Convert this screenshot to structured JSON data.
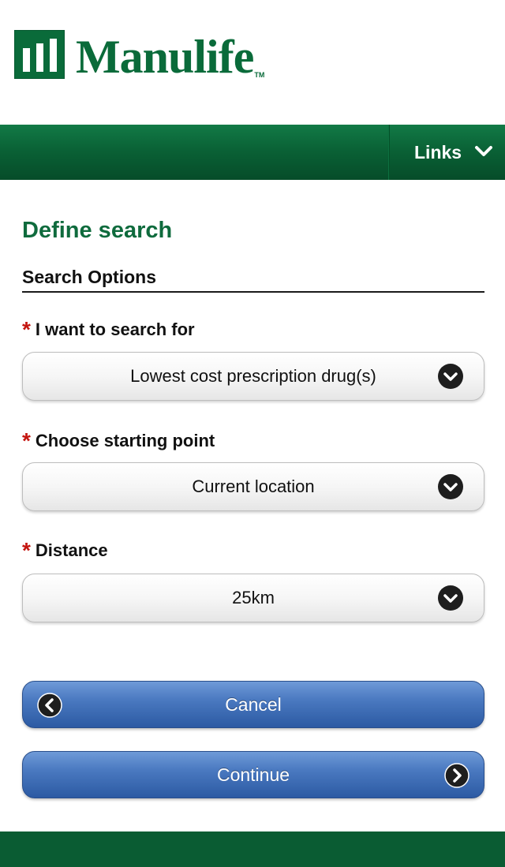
{
  "brand": {
    "name": "Manulife",
    "trademark": "TM",
    "color": "#0a6b3a"
  },
  "navbar": {
    "links_label": "Links",
    "links_icon": "chevron-down-icon"
  },
  "page": {
    "title": "Define search",
    "section_title": "Search Options"
  },
  "fields": [
    {
      "label": "I want to search for",
      "required_mark": "*",
      "value": "Lowest cost prescription drug(s)"
    },
    {
      "label": "Choose starting point",
      "required_mark": "*",
      "value": "Current location"
    },
    {
      "label": "Distance",
      "required_mark": "*",
      "value": "25km"
    }
  ],
  "buttons": {
    "cancel_label": "Cancel",
    "cancel_icon": "chevron-left-icon",
    "continue_label": "Continue",
    "continue_icon": "chevron-right-icon"
  },
  "colors": {
    "title_green": "#0f6b3d",
    "required_red": "#c4150f",
    "button_blue": "#2c5aa3"
  }
}
